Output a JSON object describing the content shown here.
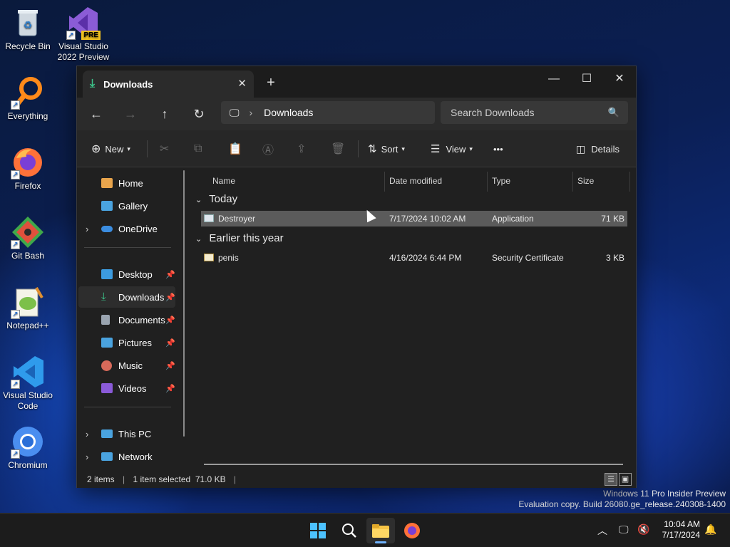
{
  "desktop": {
    "icons": [
      {
        "label": "Recycle Bin",
        "icon": "recycle-bin-icon"
      },
      {
        "label": "Visual Studio 2022 Preview",
        "icon": "visual-studio-icon",
        "badge": "PRE"
      },
      {
        "label": "Everything",
        "icon": "everything-search-icon"
      },
      {
        "label": "Firefox",
        "icon": "firefox-icon"
      },
      {
        "label": "Git Bash",
        "icon": "git-bash-icon"
      },
      {
        "label": "Notepad++",
        "icon": "notepad-plus-plus-icon"
      },
      {
        "label": "Visual Studio Code",
        "icon": "vscode-icon"
      },
      {
        "label": "Chromium",
        "icon": "chromium-icon"
      }
    ],
    "watermark": {
      "line1": "Windows 11 Pro Insider Preview",
      "line2": "Evaluation copy. Build 26080.ge_release.240308-1400"
    }
  },
  "explorer": {
    "tab_title": "Downloads",
    "window_controls": {
      "minimize": "—",
      "maximize": "☐",
      "close": "✕"
    },
    "new_tab": "+",
    "address": "Downloads",
    "search_placeholder": "Search Downloads",
    "toolbar": {
      "new": "New",
      "sort": "Sort",
      "view": "View",
      "more": "•••",
      "details": "Details"
    },
    "sidebar": {
      "top": [
        {
          "label": "Home",
          "color": "#e8a44c"
        },
        {
          "label": "Gallery",
          "color": "#4aa3df"
        },
        {
          "label": "OneDrive",
          "color": "#3b8de0",
          "expandable": true
        }
      ],
      "quick": [
        {
          "label": "Desktop",
          "color": "#3c9be0",
          "pinned": true
        },
        {
          "label": "Downloads",
          "color": "#3cc48a",
          "pinned": true,
          "selected": true
        },
        {
          "label": "Documents",
          "color": "#9aa4b0",
          "pinned": true
        },
        {
          "label": "Pictures",
          "color": "#4aa3df",
          "pinned": true
        },
        {
          "label": "Music",
          "color": "#d86a5a",
          "pinned": true
        },
        {
          "label": "Videos",
          "color": "#8a5ad8",
          "pinned": true
        }
      ],
      "bottom": [
        {
          "label": "This PC",
          "color": "#4aa3df",
          "expandable": true
        },
        {
          "label": "Network",
          "color": "#4aa3df",
          "expandable": true
        }
      ]
    },
    "columns": [
      "Name",
      "Date modified",
      "Type",
      "Size"
    ],
    "groups": [
      {
        "title": "Today",
        "files": [
          {
            "name": "Destroyer",
            "date": "7/17/2024 10:02 AM",
            "type": "Application",
            "size": "71 KB",
            "selected": true
          }
        ]
      },
      {
        "title": "Earlier this year",
        "files": [
          {
            "name": "penis",
            "date": "4/16/2024 6:44 PM",
            "type": "Security Certificate",
            "size": "3 KB",
            "selected": false
          }
        ]
      }
    ],
    "status": {
      "count": "2 items",
      "selected": "1 item selected  71.0 KB"
    }
  },
  "taskbar": {
    "apps": [
      "start-icon",
      "search-icon",
      "file-explorer-icon",
      "firefox-icon"
    ],
    "time": "10:04 AM",
    "date": "7/17/2024"
  }
}
